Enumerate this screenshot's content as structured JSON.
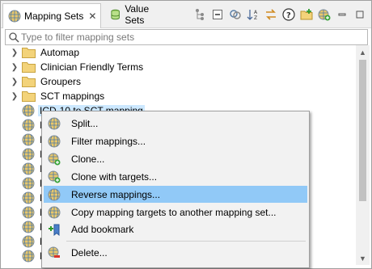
{
  "tabs": [
    {
      "label": "Mapping Sets",
      "icon": "globe-icon",
      "active": true
    },
    {
      "label": "Value Sets",
      "icon": "value-sets-icon",
      "active": false
    }
  ],
  "tab_close_glyph": "✕",
  "toolbar": {
    "icons": [
      "hierarchy-icon",
      "collapse-all-icon",
      "link-with-editor-icon",
      "sort-icon",
      "swap-icon",
      "help-icon",
      "new-folder-icon",
      "new-mapping-set-icon",
      "minimize-icon",
      "maximize-icon"
    ]
  },
  "filter": {
    "placeholder": "Type to filter mapping sets"
  },
  "tree": {
    "folders": [
      {
        "label": "Automap"
      },
      {
        "label": "Clinician Friendly Terms"
      },
      {
        "label": "Groupers"
      },
      {
        "label": "SCT mappings"
      }
    ],
    "selected_item": {
      "label": "ICD-10 to SCT mapping"
    },
    "partial_items": [
      {
        "label": "I"
      },
      {
        "label": "I"
      },
      {
        "label": "I"
      },
      {
        "label": "I"
      },
      {
        "label": "L"
      },
      {
        "label": "L"
      },
      {
        "label": "N"
      },
      {
        "label": "N"
      },
      {
        "label": "N"
      },
      {
        "label": "N"
      }
    ]
  },
  "context_menu": {
    "items": [
      {
        "label": "Split...",
        "icon": "globe-icon"
      },
      {
        "label": "Filter mappings...",
        "icon": "globe-icon"
      },
      {
        "label": "Clone...",
        "icon": "globe-add-icon"
      },
      {
        "label": "Clone with targets...",
        "icon": "globe-add-icon"
      },
      {
        "label": "Reverse mappings...",
        "icon": "globe-icon",
        "highlighted": true
      },
      {
        "label": "Copy mapping targets to another mapping set...",
        "icon": "globe-icon"
      },
      {
        "label": "Add bookmark",
        "icon": "add-bookmark-icon"
      },
      {
        "label": "Delete...",
        "icon": "globe-delete-icon"
      }
    ]
  },
  "colors": {
    "selection": "#cce8ff",
    "menu_highlight": "#91c9f7",
    "folder": "#f3d37a"
  }
}
